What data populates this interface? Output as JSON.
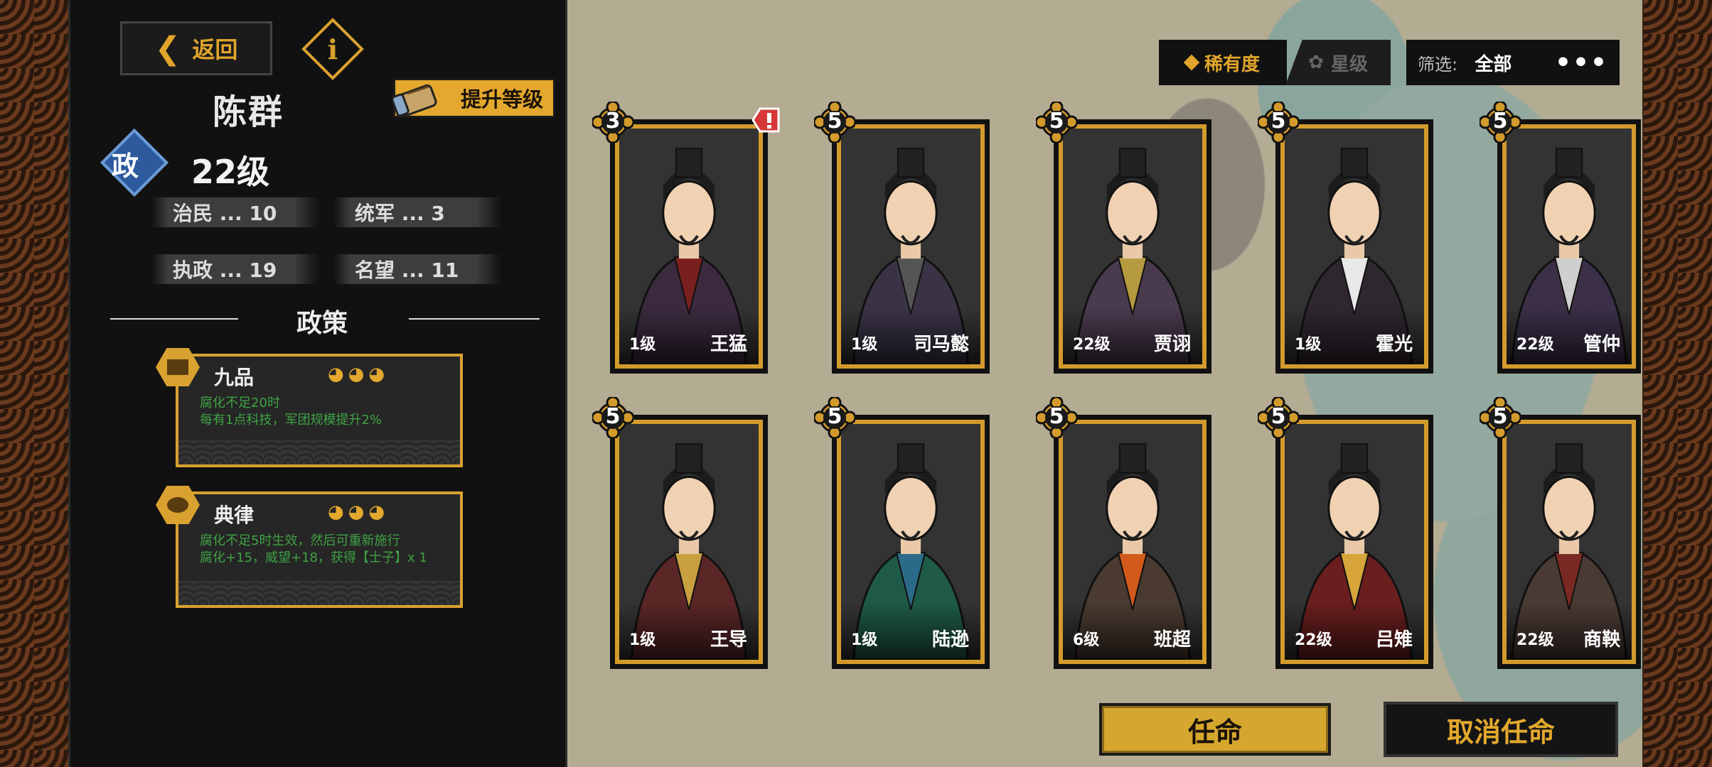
{
  "left": {
    "back_label": "返回",
    "info_symbol": "i",
    "name": "陈群",
    "upgrade_label": "提升等级",
    "role_badge": "政",
    "level": "22级",
    "stats": [
      {
        "label": "治民 ... 10"
      },
      {
        "label": "统军 ... 3"
      },
      {
        "label": "执政 ... 19"
      },
      {
        "label": "名望 ... 11"
      }
    ],
    "policy_header": "政策",
    "policies": [
      {
        "name": "九品",
        "stars": "◕◕◕",
        "desc": "腐化不足20时\n每有1点科技，军团规模提升2%"
      },
      {
        "name": "典律",
        "stars": "◕◕◕",
        "desc": "腐化不足5时生效，然后可重新施行\n腐化+15，威望+18，获得【士子】x 1"
      }
    ]
  },
  "filters": {
    "rarity_label": "稀有度",
    "star_label": "星级",
    "filter_label": "筛选:",
    "filter_value": "全部",
    "more": "•••"
  },
  "cards": [
    {
      "stars": "3",
      "level": "1级",
      "name": "王猛",
      "alert": true,
      "robe": "#3b2a3e",
      "accent": "#7a1f1f"
    },
    {
      "stars": "5",
      "level": "1级",
      "name": "司马懿",
      "alert": false,
      "robe": "#3a3346",
      "accent": "#555"
    },
    {
      "stars": "5",
      "level": "22级",
      "name": "贾诩",
      "alert": false,
      "robe": "#4a3a4e",
      "accent": "#b59a40"
    },
    {
      "stars": "5",
      "level": "1级",
      "name": "霍光",
      "alert": false,
      "robe": "#2f2730",
      "accent": "#e8e8e8"
    },
    {
      "stars": "5",
      "level": "22级",
      "name": "管仲",
      "alert": false,
      "robe": "#3b3048",
      "accent": "#cfcfcf"
    },
    {
      "stars": "5",
      "level": "1级",
      "name": "王导",
      "alert": false,
      "robe": "#5b2626",
      "accent": "#c9a040"
    },
    {
      "stars": "5",
      "level": "1级",
      "name": "陆逊",
      "alert": false,
      "robe": "#1f5a48",
      "accent": "#2b6a88"
    },
    {
      "stars": "5",
      "level": "6级",
      "name": "班超",
      "alert": false,
      "robe": "#4a3a30",
      "accent": "#d25a1a"
    },
    {
      "stars": "5",
      "level": "22级",
      "name": "吕雉",
      "alert": false,
      "robe": "#6a1e1e",
      "accent": "#d7a53a"
    },
    {
      "stars": "5",
      "level": "22级",
      "name": "商鞅",
      "alert": false,
      "robe": "#4a3a34",
      "accent": "#7a2a22"
    }
  ],
  "actions": {
    "appoint": "任命",
    "cancel": "取消任命"
  },
  "colors": {
    "gold": "#d9a130",
    "panel": "#111111",
    "policy_text": "#3ea244",
    "zheng_blue": "#2c5a9c"
  }
}
